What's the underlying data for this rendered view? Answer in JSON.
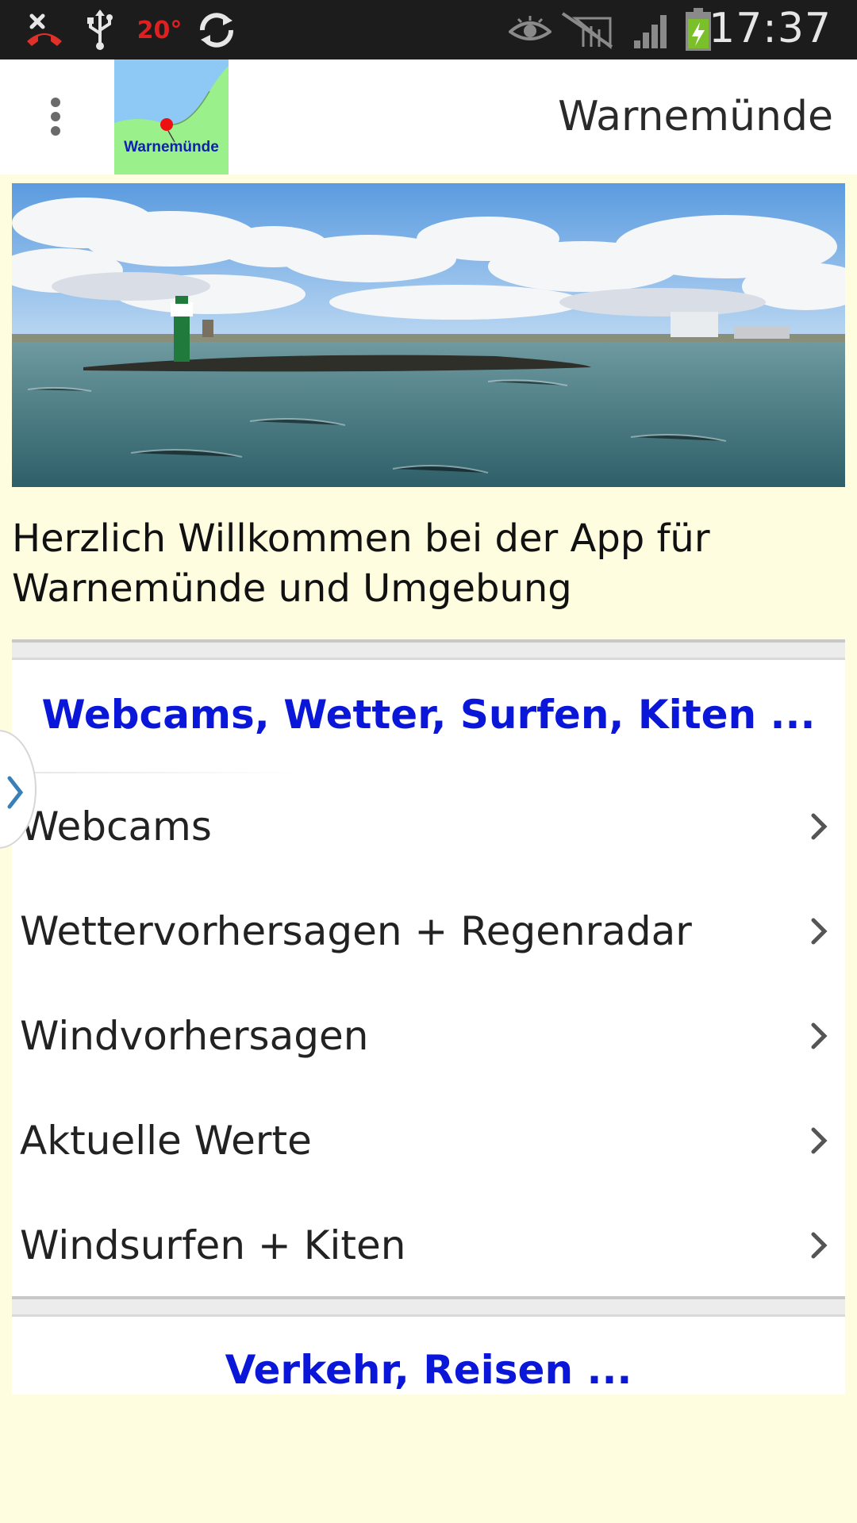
{
  "status_bar": {
    "temperature": "20°",
    "time": "17:37",
    "icons": [
      "missed-call-icon",
      "usb-icon",
      "temperature-icon",
      "sync-icon",
      "eye-icon",
      "no-signal-icon",
      "signal-icon",
      "battery-charging-icon"
    ]
  },
  "action_bar": {
    "title": "Warnemünde",
    "logo_text": "Warnemünde"
  },
  "welcome_text": "Herzlich Willkommen bei der App für Warnemünde und Umgebung",
  "section1": {
    "header": "Webcams, Wetter, Surfen, Kiten ...",
    "items": [
      {
        "label": "Webcams"
      },
      {
        "label": "Wettervorhersagen + Regenradar"
      },
      {
        "label": "Windvorhersagen"
      },
      {
        "label": "Aktuelle Werte"
      },
      {
        "label": "Windsurfen + Kiten"
      }
    ]
  },
  "section2": {
    "header": "Verkehr, Reisen ..."
  },
  "colors": {
    "background": "#fffde0",
    "section_header": "#0a16d8",
    "status_bar": "#1c1c1c"
  }
}
